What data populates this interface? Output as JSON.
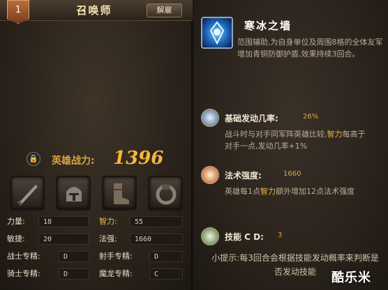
{
  "header": {
    "level": "1",
    "title": "召唤师",
    "unlock_label": "解雇"
  },
  "power": {
    "label": "英雄战力:",
    "value": "1396"
  },
  "equipment": [
    "sword-icon",
    "helmet-icon",
    "boots-icon",
    "ring-icon"
  ],
  "stats": [
    {
      "k": "力量:",
      "v": "18"
    },
    {
      "k": "智力:",
      "v": "55"
    },
    {
      "k": "敏捷:",
      "v": "20"
    },
    {
      "k": "法强:",
      "v": "1660"
    },
    {
      "k": "战士专精:",
      "v": "D"
    },
    {
      "k": "射手专精:",
      "v": "D"
    },
    {
      "k": "骑士专精:",
      "v": "D"
    },
    {
      "k": "魔龙专精:",
      "v": "C"
    }
  ],
  "skill": {
    "name": "寒冰之墙",
    "desc": "范围辅助,为自身单位及周围8格的全体友军增加青铜防御护盾,效果持续3回合。"
  },
  "rows": [
    {
      "label": "基础发动几率:",
      "value": "26%",
      "text_a": "战斗时与对手同军阵英雄比较,",
      "text_hl": "智力",
      "text_b": "每高于对手一点,发动几率+1%"
    },
    {
      "label": "法术强度:",
      "value": "1660",
      "text_a": "英雄每1点",
      "text_hl": "智力",
      "text_b": "额外增加12点法术强度"
    },
    {
      "label": "技能 C D:",
      "value": "3"
    }
  ],
  "tip": "小提示:每3回合会根据技能发动概率来判断是否发动技能",
  "watermark": "酷乐米",
  "colors": {
    "accent": "#d8a43e",
    "highlight": "#e8b93c"
  }
}
